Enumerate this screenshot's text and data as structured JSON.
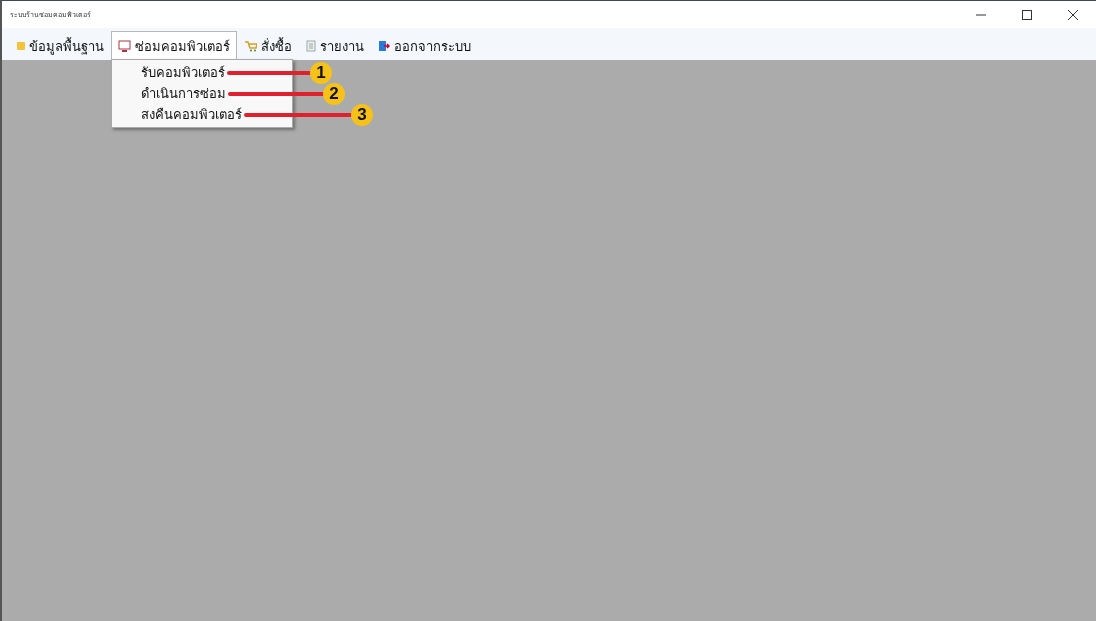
{
  "window": {
    "title": "ระบบร้านซ่อมคอมพิวเตอร์"
  },
  "menu": [
    {
      "label": "ข้อมูลพื้นฐาน",
      "kind": "folder",
      "selected": false
    },
    {
      "label": "ซ่อมคอมพิวเตอร์",
      "kind": "monitor",
      "selected": true,
      "dropdown": [
        {
          "label": "รับคอมพิวเตอร์",
          "callout": "1"
        },
        {
          "label": "ดำเนินการซ่อม",
          "callout": "2"
        },
        {
          "label": "สงคืนคอมพิวเตอร์",
          "callout": "3"
        }
      ]
    },
    {
      "label": "สั่งซื้อ",
      "kind": "cart",
      "selected": false
    },
    {
      "label": "รายงาน",
      "kind": "report",
      "selected": false
    },
    {
      "label": "ออกจากระบบ",
      "kind": "exit",
      "selected": false
    }
  ]
}
